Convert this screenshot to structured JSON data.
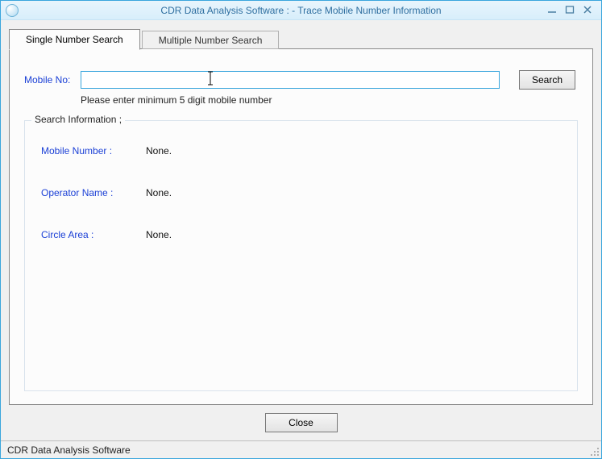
{
  "window": {
    "title": "CDR Data Analysis Software : - Trace Mobile Number Information"
  },
  "tabs": [
    {
      "label": "Single Number Search",
      "active": true
    },
    {
      "label": "Multiple Number Search",
      "active": false
    }
  ],
  "search": {
    "mobile_label": "Mobile No:",
    "mobile_value": "",
    "search_button": "Search",
    "hint": "Please enter minimum 5 digit mobile number"
  },
  "group": {
    "title": "Search Information ;",
    "rows": [
      {
        "label": "Mobile Number :",
        "value": "None."
      },
      {
        "label": "Operator Name :",
        "value": "None."
      },
      {
        "label": "Circle Area :",
        "value": "None."
      }
    ]
  },
  "footer": {
    "close_button": "Close"
  },
  "statusbar": {
    "text": "CDR Data Analysis Software"
  }
}
